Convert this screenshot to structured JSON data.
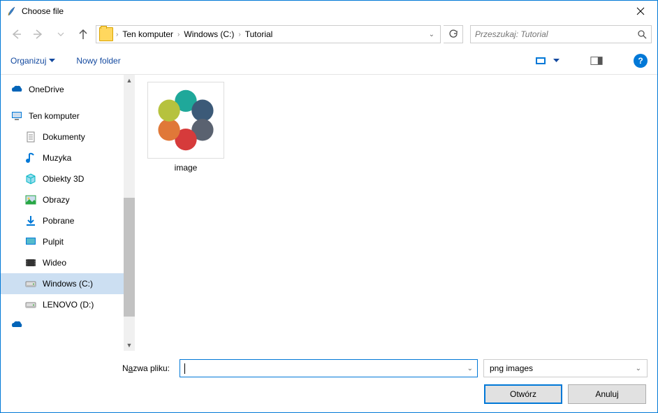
{
  "window": {
    "title": "Choose file"
  },
  "breadcrumbs": [
    "Ten komputer",
    "Windows (C:)",
    "Tutorial"
  ],
  "search": {
    "placeholder": "Przeszukaj: Tutorial"
  },
  "toolbar": {
    "organize": "Organizuj",
    "newfolder": "Nowy folder"
  },
  "sidebar": {
    "items": [
      {
        "label": "OneDrive",
        "root": true,
        "icon": "onedrive"
      },
      {
        "label": "Ten komputer",
        "root": true,
        "icon": "pc"
      },
      {
        "label": "Dokumenty",
        "icon": "doc"
      },
      {
        "label": "Muzyka",
        "icon": "music"
      },
      {
        "label": "Obiekty 3D",
        "icon": "3d"
      },
      {
        "label": "Obrazy",
        "icon": "img"
      },
      {
        "label": "Pobrane",
        "icon": "down"
      },
      {
        "label": "Pulpit",
        "icon": "desk"
      },
      {
        "label": "Wideo",
        "icon": "vid"
      },
      {
        "label": "Windows (C:)",
        "icon": "drive",
        "selected": true
      },
      {
        "label": "LENOVO (D:)",
        "icon": "drive"
      }
    ]
  },
  "files": [
    {
      "name": "image"
    }
  ],
  "bottom": {
    "filename_label_pre": "N",
    "filename_label_u": "a",
    "filename_label_post": "zwa pliku:",
    "filename_value": "",
    "filter": "png images",
    "open_pre": "",
    "open_u": "O",
    "open_post": "twórz",
    "cancel": "Anuluj"
  }
}
